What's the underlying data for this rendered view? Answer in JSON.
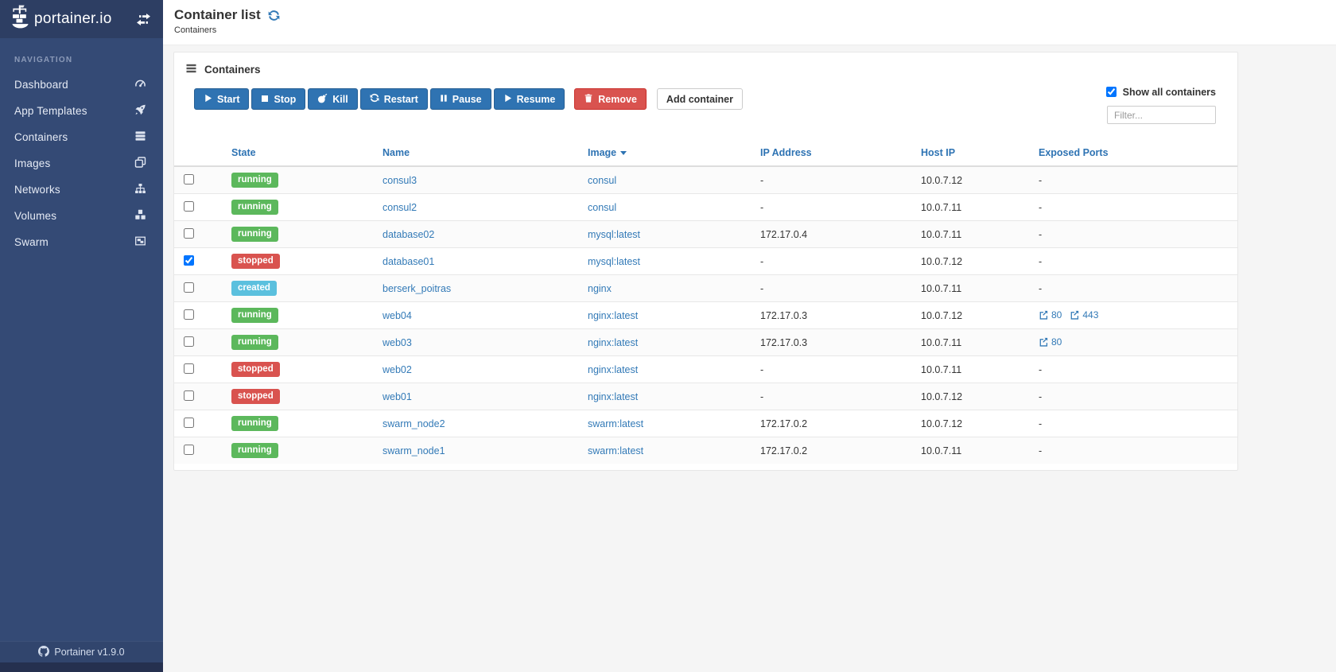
{
  "sidebar": {
    "brand": "portainer.io",
    "nav_label": "NAVIGATION",
    "items": [
      {
        "label": "Dashboard",
        "icon": "tachometer-icon"
      },
      {
        "label": "App Templates",
        "icon": "rocket-icon"
      },
      {
        "label": "Containers",
        "icon": "containers-icon"
      },
      {
        "label": "Images",
        "icon": "images-icon"
      },
      {
        "label": "Networks",
        "icon": "sitemap-icon"
      },
      {
        "label": "Volumes",
        "icon": "cubes-icon"
      },
      {
        "label": "Swarm",
        "icon": "object-group-icon"
      }
    ],
    "footer": "Portainer v1.9.0"
  },
  "header": {
    "title": "Container list",
    "breadcrumb": "Containers"
  },
  "panel": {
    "title": "Containers",
    "actions": [
      {
        "label": "Start",
        "icon": "play-icon",
        "style": "primary"
      },
      {
        "label": "Stop",
        "icon": "stop-icon",
        "style": "primary"
      },
      {
        "label": "Kill",
        "icon": "bomb-icon",
        "style": "primary"
      },
      {
        "label": "Restart",
        "icon": "refresh-icon",
        "style": "primary"
      },
      {
        "label": "Pause",
        "icon": "pause-icon",
        "style": "primary"
      },
      {
        "label": "Resume",
        "icon": "play-icon",
        "style": "primary"
      },
      {
        "label": "Remove",
        "icon": "trash-icon",
        "style": "danger"
      }
    ],
    "add_button": "Add container",
    "show_all_label": "Show all containers",
    "show_all_checked": true,
    "filter_placeholder": "Filter..."
  },
  "table": {
    "columns": [
      "State",
      "Name",
      "Image",
      "IP Address",
      "Host IP",
      "Exposed Ports"
    ],
    "sorted_by": "Image",
    "rows": [
      {
        "checked": false,
        "state": "running",
        "name": "consul3",
        "image": "consul",
        "ip": "-",
        "host_ip": "10.0.7.12",
        "ports": []
      },
      {
        "checked": false,
        "state": "running",
        "name": "consul2",
        "image": "consul",
        "ip": "-",
        "host_ip": "10.0.7.11",
        "ports": []
      },
      {
        "checked": false,
        "state": "running",
        "name": "database02",
        "image": "mysql:latest",
        "ip": "172.17.0.4",
        "host_ip": "10.0.7.11",
        "ports": []
      },
      {
        "checked": true,
        "state": "stopped",
        "name": "database01",
        "image": "mysql:latest",
        "ip": "-",
        "host_ip": "10.0.7.12",
        "ports": []
      },
      {
        "checked": false,
        "state": "created",
        "name": "berserk_poitras",
        "image": "nginx",
        "ip": "-",
        "host_ip": "10.0.7.11",
        "ports": []
      },
      {
        "checked": false,
        "state": "running",
        "name": "web04",
        "image": "nginx:latest",
        "ip": "172.17.0.3",
        "host_ip": "10.0.7.12",
        "ports": [
          "80",
          "443"
        ]
      },
      {
        "checked": false,
        "state": "running",
        "name": "web03",
        "image": "nginx:latest",
        "ip": "172.17.0.3",
        "host_ip": "10.0.7.11",
        "ports": [
          "80"
        ]
      },
      {
        "checked": false,
        "state": "stopped",
        "name": "web02",
        "image": "nginx:latest",
        "ip": "-",
        "host_ip": "10.0.7.11",
        "ports": []
      },
      {
        "checked": false,
        "state": "stopped",
        "name": "web01",
        "image": "nginx:latest",
        "ip": "-",
        "host_ip": "10.0.7.12",
        "ports": []
      },
      {
        "checked": false,
        "state": "running",
        "name": "swarm_node2",
        "image": "swarm:latest",
        "ip": "172.17.0.2",
        "host_ip": "10.0.7.12",
        "ports": []
      },
      {
        "checked": false,
        "state": "running",
        "name": "swarm_node1",
        "image": "swarm:latest",
        "ip": "172.17.0.2",
        "host_ip": "10.0.7.11",
        "ports": []
      }
    ]
  },
  "colors": {
    "sidebar_bg": "#344a75",
    "sidebar_header_bg": "#2d3e63",
    "link": "#337ab7",
    "table_header_text": "#2e73b3",
    "button_primary": "#2f73b2",
    "button_danger": "#d9534f",
    "state_running": "#5cb85c",
    "state_stopped": "#d9534f",
    "state_created": "#5bc0de",
    "content_bg": "#f5f5f5"
  },
  "icons": {
    "brand": "portainer-logo-icon",
    "sidebar_toggle": "exchange-icon",
    "title_refresh": "refresh-icon",
    "panel_title": "tasks-icon",
    "exposed_ports": "external-link-icon",
    "footer": "github-icon"
  }
}
